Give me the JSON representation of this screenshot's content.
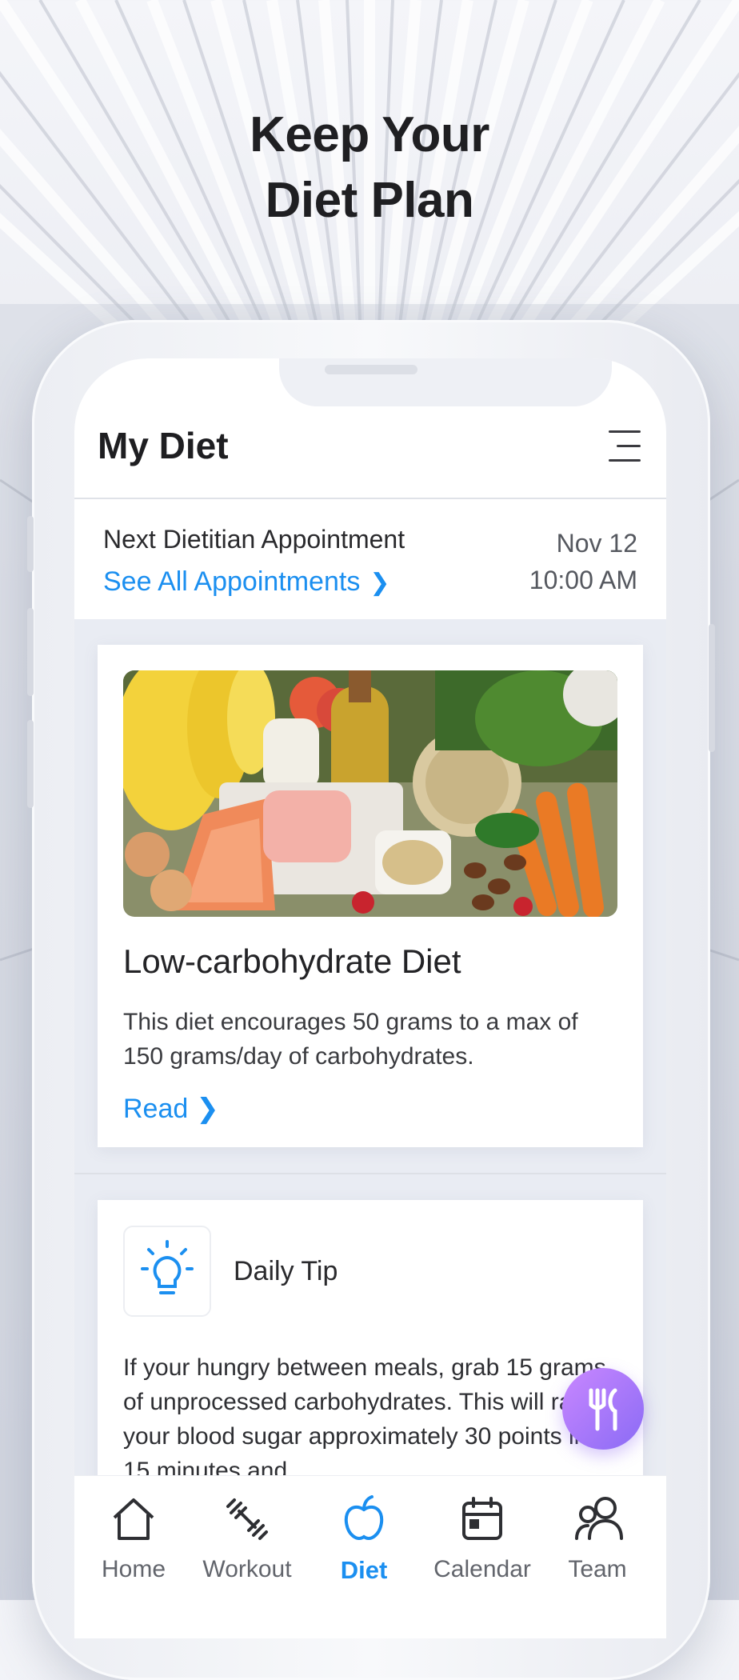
{
  "headline": {
    "line1": "Keep Your",
    "line2": "Diet Plan"
  },
  "app": {
    "title": "My Diet"
  },
  "appointment": {
    "label": "Next Dietitian Appointment",
    "link": "See All Appointments",
    "date": "Nov 12",
    "time": "10:00 AM"
  },
  "diet_card": {
    "title": "Low-carbohydrate Diet",
    "description": "This diet encourages 50 grams to a max of 150 grams/day of carbohydrates.",
    "link": "Read"
  },
  "tip_card": {
    "title": "Daily Tip",
    "text": "If your hungry between meals, grab 15 grams of unprocessed carbohydrates. This will raise your blood sugar approximately 30 points in 15 minutes and"
  },
  "tabs": [
    {
      "label": "Home",
      "icon": "home-icon",
      "active": false
    },
    {
      "label": "Workout",
      "icon": "dumbbell-icon",
      "active": false
    },
    {
      "label": "Diet",
      "icon": "apple-icon",
      "active": true
    },
    {
      "label": "Calendar",
      "icon": "calendar-icon",
      "active": false
    },
    {
      "label": "Team",
      "icon": "team-icon",
      "active": false
    }
  ],
  "colors": {
    "accent": "#1b8ff0",
    "fab": "#a97af8",
    "text": "#1e1e21"
  }
}
